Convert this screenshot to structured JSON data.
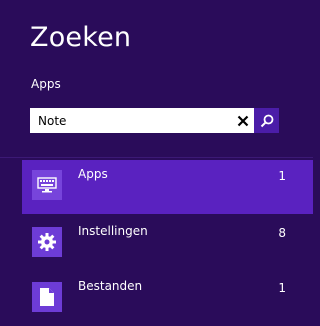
{
  "charm": {
    "title": "Zoeken",
    "scope": "Apps"
  },
  "search": {
    "value": "Note",
    "clear_icon": "close-icon",
    "search_icon": "search-icon"
  },
  "results": [
    {
      "label": "Apps",
      "count": "1",
      "icon": "keyboard-icon",
      "selected": true
    },
    {
      "label": "Instellingen",
      "count": "8",
      "icon": "gear-icon",
      "selected": false
    },
    {
      "label": "Bestanden",
      "count": "1",
      "icon": "document-icon",
      "selected": false
    }
  ],
  "colors": {
    "background": "#2a0c5a",
    "accent": "#5a22c0"
  }
}
